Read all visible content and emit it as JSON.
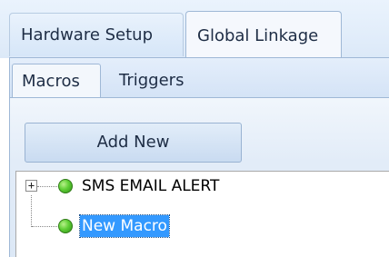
{
  "outer_tabs": [
    {
      "label": "Hardware Setup",
      "active": false
    },
    {
      "label": "Global Linkage",
      "active": true
    }
  ],
  "inner_tabs": [
    {
      "label": "Macros",
      "active": true
    },
    {
      "label": "Triggers",
      "active": false
    }
  ],
  "macros_panel": {
    "add_button_label": "Add New"
  },
  "macro_tree": {
    "items": [
      {
        "label": "SMS EMAIL ALERT",
        "expandable": true,
        "expander_glyph": "+",
        "status_color": "#4cc52b",
        "selected": false
      },
      {
        "label": "New Macro",
        "expandable": false,
        "status_color": "#4cc52b",
        "selected": true
      }
    ]
  },
  "colors": {
    "selection": "#3399ff",
    "status_green": "#4cc52b"
  }
}
